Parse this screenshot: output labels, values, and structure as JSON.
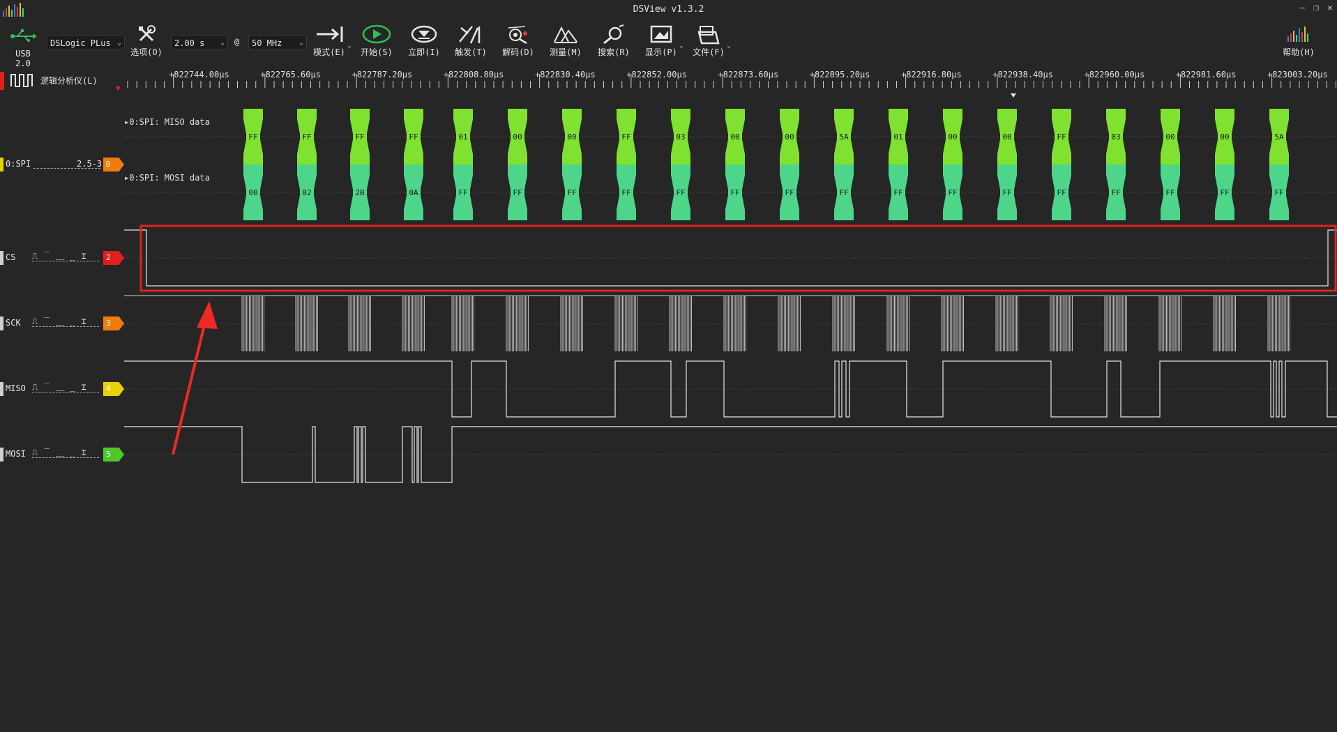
{
  "window": {
    "title": "DSView v1.3.2",
    "controls": [
      "minimize",
      "restore",
      "close"
    ]
  },
  "toolbar": {
    "usb_label": "USB 2.0",
    "device": "DSLogic PLus",
    "options_label": "选项(O)",
    "duration": "2.00 s",
    "at": "@",
    "samplerate": "50 MHz",
    "mode_label": "模式(E)",
    "start_label": "开始(S)",
    "instant_label": "立即(I)",
    "trigger_label": "触发(T)",
    "decode_label": "解码(D)",
    "measure_label": "测量(M)",
    "search_label": "搜索(R)",
    "display_label": "显示(P)",
    "file_label": "文件(F)",
    "help_label": "帮助(H)"
  },
  "device_panel": {
    "label": "逻辑分析仪(L)"
  },
  "ruler": {
    "labels": [
      "+822744.00μs",
      "+822765.60μs",
      "+822787.20μs",
      "+822808.80μs",
      "+822830.40μs",
      "+822852.00μs",
      "+822873.60μs",
      "+822895.20μs",
      "+822916.80μs",
      "+822938.40μs",
      "+822960.00μs",
      "+822981.60μs",
      "+823003.20μs"
    ]
  },
  "decoder": {
    "name": "0:SPI",
    "range": "2.5-3",
    "badge": "D",
    "badge_color": "#f07d0a",
    "strip_color": "#e8d200",
    "rows": [
      {
        "label": "0:SPI: MISO data",
        "color": "#7fe230",
        "values": [
          "FF",
          "FF",
          "FF",
          "FF",
          "01",
          "00",
          "00",
          "FF",
          "03",
          "00",
          "00",
          "5A",
          "01",
          "00",
          "00",
          "FF",
          "03",
          "00",
          "00",
          "5A"
        ]
      },
      {
        "label": "0:SPI: MOSI data",
        "color": "#4dd68a",
        "values": [
          "00",
          "02",
          "2B",
          "0A",
          "FF",
          "FF",
          "FF",
          "FF",
          "FF",
          "FF",
          "FF",
          "FF",
          "FF",
          "FF",
          "FF",
          "FF",
          "FF",
          "FF",
          "FF",
          "FF"
        ]
      }
    ]
  },
  "channels": [
    {
      "name": "CS",
      "trigger": "⎍ ‾ ⎽ _ ⌶",
      "index": "2",
      "color": "#e02020"
    },
    {
      "name": "SCK",
      "trigger": "⎍ ‾ ⎽ _ ⌶",
      "index": "3",
      "color": "#f07d0a"
    },
    {
      "name": "MISO",
      "trigger": "⎍ ‾ ⎽ _ ⌶",
      "index": "4",
      "color": "#e8d200"
    },
    {
      "name": "MOSI",
      "trigger": "⎍ ‾ ⎽ _ ⌶",
      "index": "5",
      "color": "#4cc82a"
    }
  ],
  "annotation": {
    "highlight_color": "#e0231c",
    "arrow_color": "#ee2a24"
  }
}
